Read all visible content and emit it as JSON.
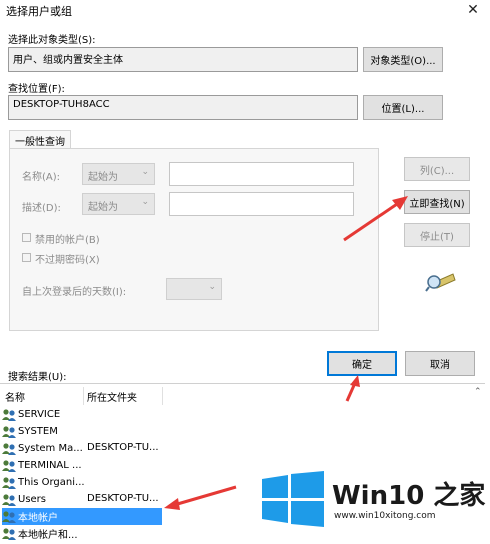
{
  "window": {
    "title": "选择用户或组",
    "close_glyph": "✕"
  },
  "object_type": {
    "label": "选择此对象类型(S):",
    "value": "用户、组或内置安全主体",
    "button": "对象类型(O)..."
  },
  "location": {
    "label": "查找位置(F):",
    "value": "DESKTOP-TUH8ACC",
    "button": "位置(L)..."
  },
  "general_query": {
    "tab": "一般性查询",
    "name_label": "名称(A):",
    "name_combo": "起始为",
    "desc_label": "描述(D):",
    "desc_combo": "起始为",
    "disabled_accounts": "禁用的帐户(B)",
    "no_expire_pw": "不过期密码(X)",
    "days_since_login": "自上次登录后的天数(I):"
  },
  "side_buttons": {
    "columns": "列(C)...",
    "find_now": "立即查找(N)",
    "stop": "停止(T)"
  },
  "ok": "确定",
  "cancel": "取消",
  "results": {
    "label": "搜索结果(U):",
    "columns": [
      "名称",
      "所在文件夹"
    ],
    "rows": [
      {
        "name": "SERVICE",
        "folder": ""
      },
      {
        "name": "SYSTEM",
        "folder": ""
      },
      {
        "name": "System Ma...",
        "folder": "DESKTOP-TU..."
      },
      {
        "name": "TERMINAL ...",
        "folder": ""
      },
      {
        "name": "This Organi...",
        "folder": ""
      },
      {
        "name": "Users",
        "folder": "DESKTOP-TU..."
      },
      {
        "name": "本地帐户",
        "folder": ""
      },
      {
        "name": "本地帐户和...",
        "folder": ""
      }
    ],
    "selected_index": 6
  },
  "watermark": {
    "brand": "Win10 之家",
    "url": "www.win10xitong.com"
  },
  "colors": {
    "accent": "#0078d7",
    "selection": "#3399ff",
    "annotation": "#e53935"
  }
}
